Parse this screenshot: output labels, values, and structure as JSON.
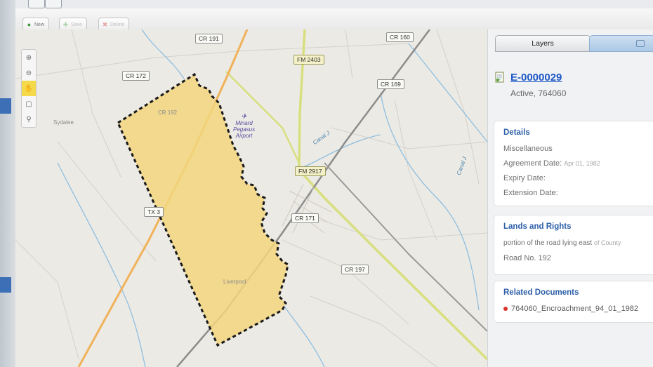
{
  "toolbar": {
    "new_label": "New",
    "save_label": "Save",
    "delete_label": "Delete"
  },
  "map": {
    "road_labels": {
      "cr191": "CR 191",
      "cr160": "CR 160",
      "cr172": "CR 172",
      "fm2403": "FM 2403",
      "cr169": "CR 169",
      "fm2917": "FM 2917",
      "cr171": "CR 171",
      "cr197": "CR 197",
      "tx": "TX 3",
      "cr192": "CR 192"
    },
    "places": {
      "sydalee": "Sydalee",
      "liverpool": "Liverpool"
    },
    "airport": [
      "Minard",
      "Pegasus",
      "Airport"
    ],
    "canal_labels": [
      "Canal J",
      "Canal J"
    ],
    "colors": {
      "parcel_fill": "#f3d67e",
      "parcel_border": "#1a1a1a",
      "railway": "#8c8c8c",
      "highway": "#f0b25b",
      "farm_road": "#d9de6a",
      "water": "#7fb3d5"
    }
  },
  "panel": {
    "tabs": {
      "layers": "Layers"
    },
    "record": {
      "id": "E-0000029",
      "status": "Active, 764060"
    },
    "details": {
      "title": "Details",
      "type": "Miscellaneous",
      "agreement_label": "Agreement Date:",
      "agreement_value": "Apr 01, 1982",
      "expiry_label": "Expiry Date:",
      "extension_label": "Extension Date:"
    },
    "lands": {
      "title": "Lands and Rights",
      "line1": "portion of the road lying east",
      "line1_blur": "of County",
      "line2": "Road No. 192"
    },
    "related": {
      "title": "Related Documents",
      "doc": "764060_Encroachment_94_01_1982"
    }
  }
}
